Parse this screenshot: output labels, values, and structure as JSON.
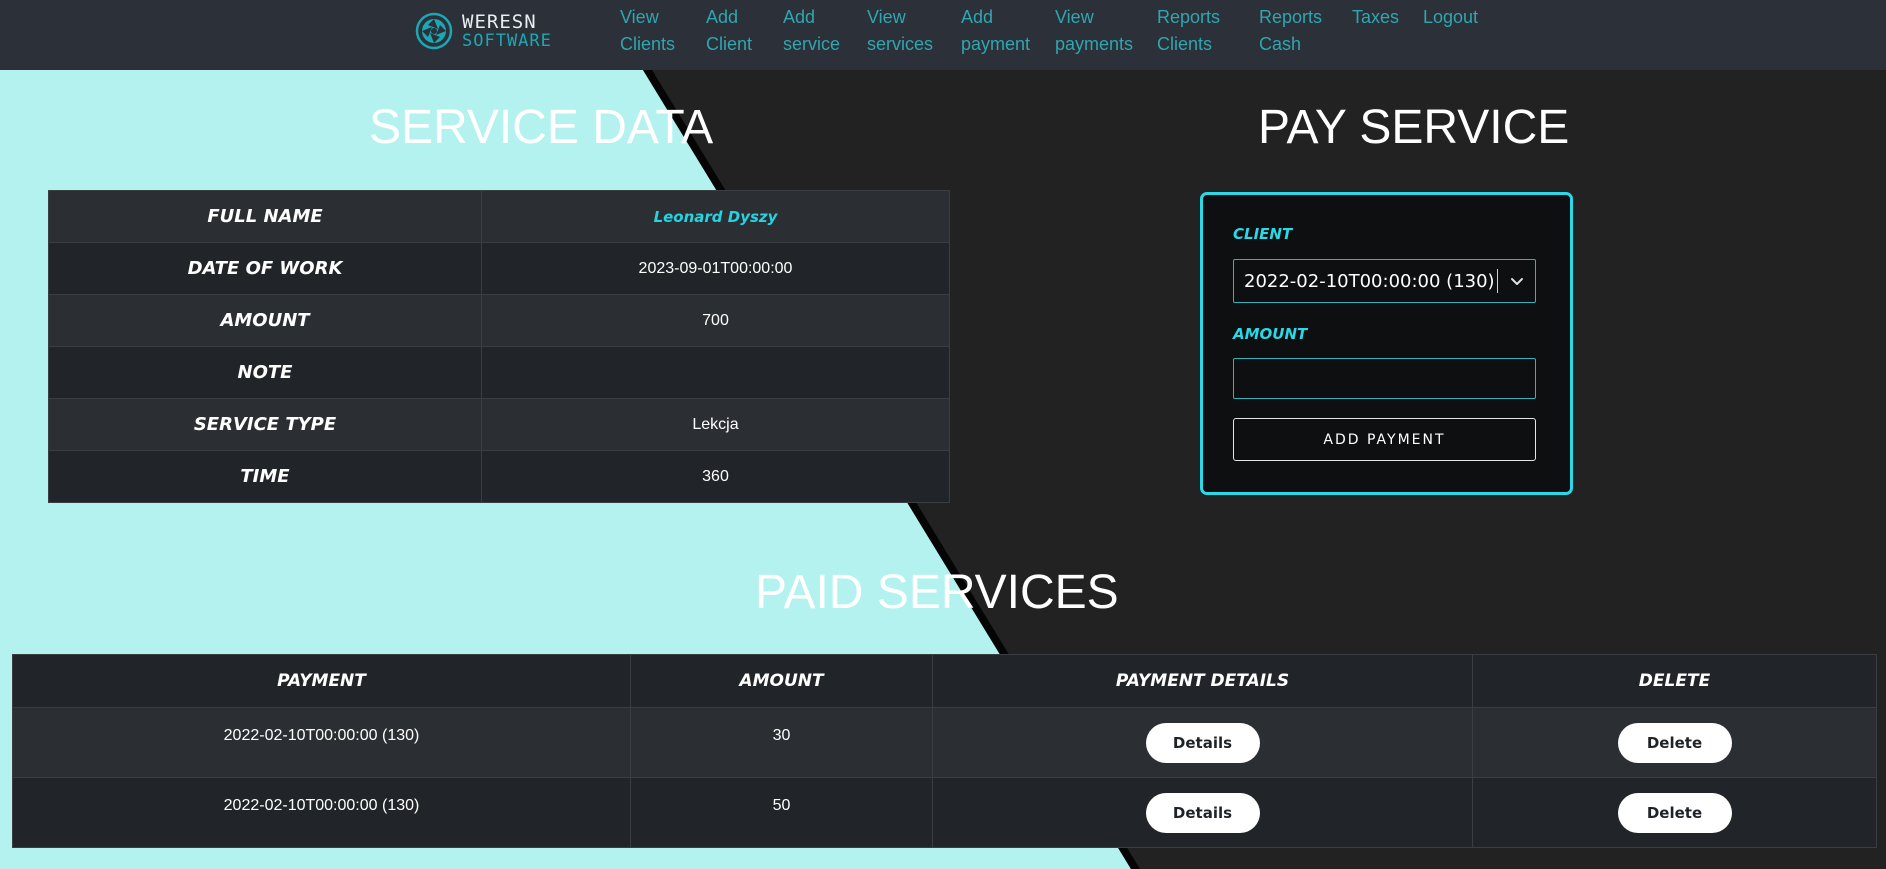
{
  "brand": {
    "logo_top": "WERESN",
    "logo_bottom": "SOFTWARE"
  },
  "nav": {
    "items": [
      {
        "line1": "View",
        "line2": "Clients"
      },
      {
        "line1": "Add",
        "line2": "Client"
      },
      {
        "line1": "Add",
        "line2": "service"
      },
      {
        "line1": "View",
        "line2": "services"
      },
      {
        "line1": "Add",
        "line2": "payment"
      },
      {
        "line1": "View",
        "line2": "payments"
      },
      {
        "line1": "Reports",
        "line2": "Clients"
      },
      {
        "line1": "Reports",
        "line2": "Cash"
      },
      {
        "line1": "Taxes",
        "line2": ""
      },
      {
        "line1": "Logout",
        "line2": ""
      }
    ]
  },
  "service_data": {
    "title": "SERVICE DATA",
    "rows": [
      {
        "label": "FULL NAME",
        "value": "Leonard Dyszy"
      },
      {
        "label": "DATE OF WORK",
        "value": "2023-09-01T00:00:00"
      },
      {
        "label": "AMOUNT",
        "value": "700"
      },
      {
        "label": "NOTE",
        "value": ""
      },
      {
        "label": "SERVICE TYPE",
        "value": "Lekcja"
      },
      {
        "label": "TIME",
        "value": "360"
      }
    ]
  },
  "pay_service": {
    "title": "PAY SERVICE",
    "client_label": "CLIENT",
    "client_selected": "2022-02-10T00:00:00 (130)",
    "amount_label": "AMOUNT",
    "amount_value": "",
    "button_label": "ADD PAYMENT"
  },
  "paid_services": {
    "title": "PAID SERVICES",
    "headers": [
      "PAYMENT",
      "AMOUNT",
      "PAYMENT DETAILS",
      "DELETE"
    ],
    "rows": [
      {
        "payment": "2022-02-10T00:00:00 (130)",
        "amount": "30",
        "details_label": "Details",
        "delete_label": "Delete"
      },
      {
        "payment": "2022-02-10T00:00:00 (130)",
        "amount": "50",
        "details_label": "Details",
        "delete_label": "Delete"
      }
    ]
  },
  "colors": {
    "accent": "#2ad8e6",
    "nav_link": "#2fa6b0",
    "background_light": "#b3f2ee",
    "background_dark": "#222222",
    "navbar": "#2c3038"
  }
}
